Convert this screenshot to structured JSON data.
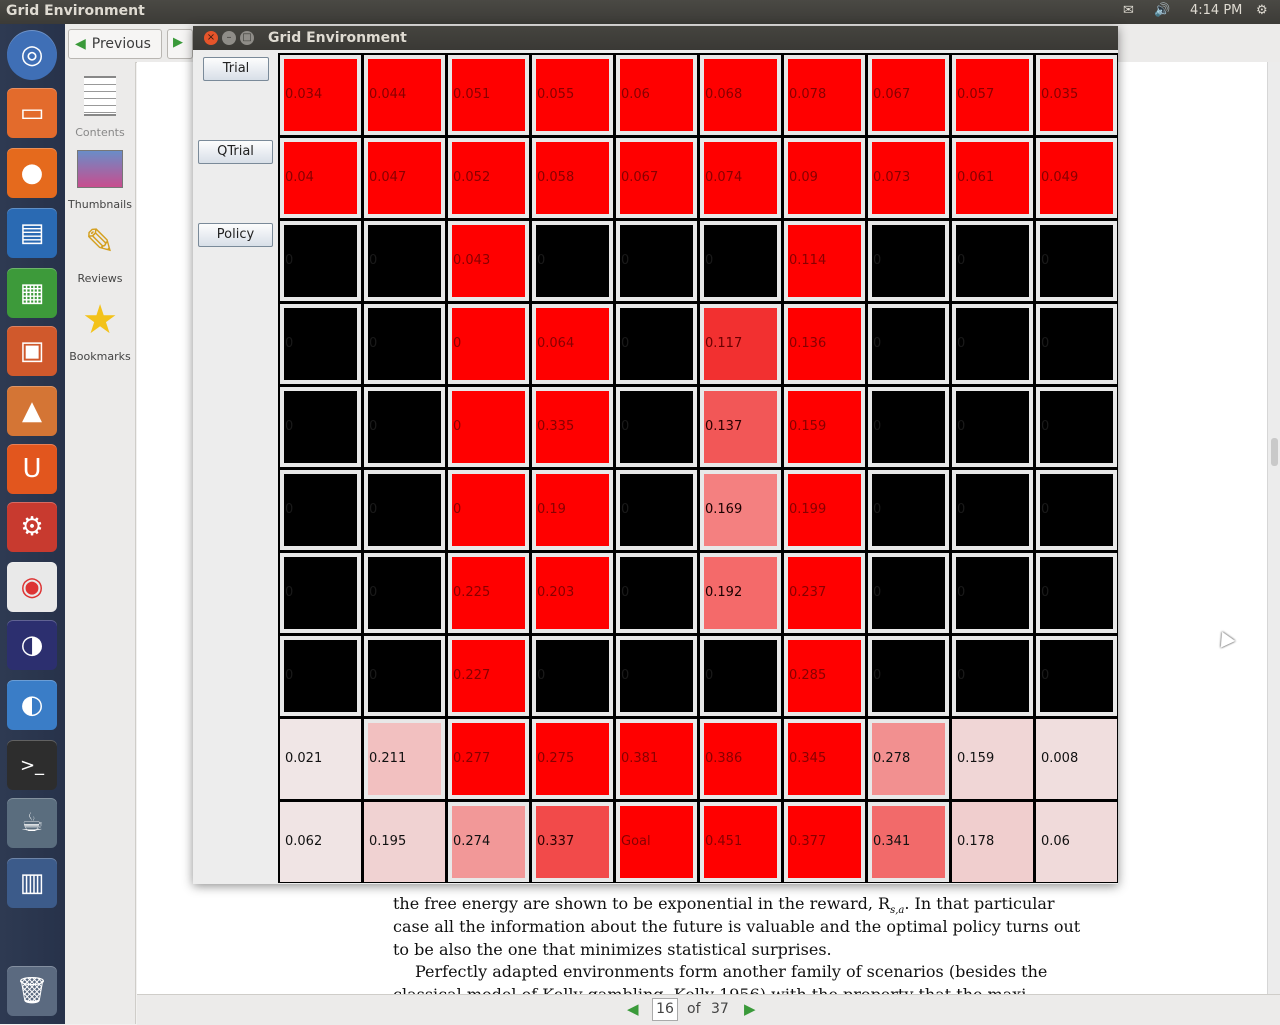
{
  "topbar": {
    "title": "Grid Environment",
    "time": "4:14 PM",
    "indicators": [
      "mail-icon",
      "volume-icon",
      "settings-gear-icon"
    ]
  },
  "launcher": {
    "items": [
      "ubuntu-dash",
      "files",
      "firefox",
      "libreoffice-writer",
      "libreoffice-calc",
      "libreoffice-impress",
      "software-center",
      "ubuntu-one",
      "system-settings",
      "chrome",
      "eclipse",
      "mendeley",
      "terminal",
      "java-app",
      "workspace-switcher",
      "trash"
    ]
  },
  "viewer": {
    "prev_label": "Previous",
    "side": {
      "contents": "Contents",
      "thumbnails": "Thumbnails",
      "reviews": "Reviews",
      "bookmarks": "Bookmarks"
    },
    "doc_lines": [
      "the free energy are shown to be exponential in the reward, R",
      "s,a",
      ". In that particular",
      "case all the information about the future is valuable and the optimal policy turns out",
      "to be also the one that minimizes statistical surprises.",
      "Perfectly adapted environments form another family of scenarios (besides the",
      "classical model of Kelly gambling, Kelly 1956) with the property that the maxi-"
    ],
    "page_current": "16",
    "page_of": "of",
    "page_total": "37"
  },
  "window": {
    "title": "Grid Environment",
    "buttons": {
      "trial": "Trial",
      "qtrial": "QTrial",
      "policy": "Policy"
    }
  },
  "grid": {
    "rows": [
      [
        {
          "v": "0.034",
          "c": "#ff0000",
          "t": "#880000"
        },
        {
          "v": "0.044",
          "c": "#ff0000",
          "t": "#880000"
        },
        {
          "v": "0.051",
          "c": "#ff0000",
          "t": "#880000"
        },
        {
          "v": "0.055",
          "c": "#ff0000",
          "t": "#880000"
        },
        {
          "v": "0.06",
          "c": "#ff0000",
          "t": "#880000"
        },
        {
          "v": "0.068",
          "c": "#ff0000",
          "t": "#880000"
        },
        {
          "v": "0.078",
          "c": "#ff0000",
          "t": "#880000"
        },
        {
          "v": "0.067",
          "c": "#ff0000",
          "t": "#880000"
        },
        {
          "v": "0.057",
          "c": "#ff0000",
          "t": "#880000"
        },
        {
          "v": "0.035",
          "c": "#ff0000",
          "t": "#880000"
        }
      ],
      [
        {
          "v": "0.04",
          "c": "#ff0000",
          "t": "#880000"
        },
        {
          "v": "0.047",
          "c": "#ff0000",
          "t": "#880000"
        },
        {
          "v": "0.052",
          "c": "#ff0000",
          "t": "#880000"
        },
        {
          "v": "0.058",
          "c": "#ff0000",
          "t": "#880000"
        },
        {
          "v": "0.067",
          "c": "#ff0000",
          "t": "#880000"
        },
        {
          "v": "0.074",
          "c": "#ff0000",
          "t": "#880000"
        },
        {
          "v": "0.09",
          "c": "#ff0000",
          "t": "#880000"
        },
        {
          "v": "0.073",
          "c": "#ff0000",
          "t": "#880000"
        },
        {
          "v": "0.061",
          "c": "#ff0000",
          "t": "#880000"
        },
        {
          "v": "0.049",
          "c": "#ff0000",
          "t": "#880000"
        }
      ],
      [
        {
          "v": "0",
          "c": "#000000",
          "t": "#1a1a1a"
        },
        {
          "v": "0",
          "c": "#000000",
          "t": "#1a1a1a"
        },
        {
          "v": "0.043",
          "c": "#ff0000",
          "t": "#880000"
        },
        {
          "v": "0",
          "c": "#000000",
          "t": "#1a1a1a"
        },
        {
          "v": "0",
          "c": "#000000",
          "t": "#1a1a1a"
        },
        {
          "v": "0",
          "c": "#000000",
          "t": "#1a1a1a"
        },
        {
          "v": "0.114",
          "c": "#ff0000",
          "t": "#880000"
        },
        {
          "v": "0",
          "c": "#000000",
          "t": "#1a1a1a"
        },
        {
          "v": "0",
          "c": "#000000",
          "t": "#1a1a1a"
        },
        {
          "v": "0",
          "c": "#000000",
          "t": "#1a1a1a"
        }
      ],
      [
        {
          "v": "0",
          "c": "#000000",
          "t": "#1a1a1a"
        },
        {
          "v": "0",
          "c": "#000000",
          "t": "#1a1a1a"
        },
        {
          "v": "0",
          "c": "#ff0000",
          "t": "#880000"
        },
        {
          "v": "0.064",
          "c": "#ff0000",
          "t": "#880000"
        },
        {
          "v": "0",
          "c": "#000000",
          "t": "#1a1a1a"
        },
        {
          "v": "0.117",
          "c": "#f23030",
          "t": "#6a0000"
        },
        {
          "v": "0.136",
          "c": "#ff0000",
          "t": "#880000"
        },
        {
          "v": "0",
          "c": "#000000",
          "t": "#1a1a1a"
        },
        {
          "v": "0",
          "c": "#000000",
          "t": "#1a1a1a"
        },
        {
          "v": "0",
          "c": "#000000",
          "t": "#1a1a1a"
        }
      ],
      [
        {
          "v": "0",
          "c": "#000000",
          "t": "#1a1a1a"
        },
        {
          "v": "0",
          "c": "#000000",
          "t": "#1a1a1a"
        },
        {
          "v": "0",
          "c": "#ff0000",
          "t": "#880000"
        },
        {
          "v": "0.335",
          "c": "#ff0000",
          "t": "#880000"
        },
        {
          "v": "0",
          "c": "#000000",
          "t": "#1a1a1a"
        },
        {
          "v": "0.137",
          "c": "#f25757",
          "t": "#2a0000"
        },
        {
          "v": "0.159",
          "c": "#ff0000",
          "t": "#880000"
        },
        {
          "v": "0",
          "c": "#000000",
          "t": "#1a1a1a"
        },
        {
          "v": "0",
          "c": "#000000",
          "t": "#1a1a1a"
        },
        {
          "v": "0",
          "c": "#000000",
          "t": "#1a1a1a"
        }
      ],
      [
        {
          "v": "0",
          "c": "#000000",
          "t": "#1a1a1a"
        },
        {
          "v": "0",
          "c": "#000000",
          "t": "#1a1a1a"
        },
        {
          "v": "0",
          "c": "#ff0000",
          "t": "#880000"
        },
        {
          "v": "0.19",
          "c": "#ff0000",
          "t": "#880000"
        },
        {
          "v": "0",
          "c": "#000000",
          "t": "#1a1a1a"
        },
        {
          "v": "0.169",
          "c": "#f48080",
          "t": "#1a0000"
        },
        {
          "v": "0.199",
          "c": "#ff0000",
          "t": "#880000"
        },
        {
          "v": "0",
          "c": "#000000",
          "t": "#1a1a1a"
        },
        {
          "v": "0",
          "c": "#000000",
          "t": "#1a1a1a"
        },
        {
          "v": "0",
          "c": "#000000",
          "t": "#1a1a1a"
        }
      ],
      [
        {
          "v": "0",
          "c": "#000000",
          "t": "#1a1a1a"
        },
        {
          "v": "0",
          "c": "#000000",
          "t": "#1a1a1a"
        },
        {
          "v": "0.225",
          "c": "#ff0000",
          "t": "#880000"
        },
        {
          "v": "0.203",
          "c": "#ff0000",
          "t": "#880000"
        },
        {
          "v": "0",
          "c": "#000000",
          "t": "#1a1a1a"
        },
        {
          "v": "0.192",
          "c": "#f46a6a",
          "t": "#1a0000"
        },
        {
          "v": "0.237",
          "c": "#ff0000",
          "t": "#880000"
        },
        {
          "v": "0",
          "c": "#000000",
          "t": "#1a1a1a"
        },
        {
          "v": "0",
          "c": "#000000",
          "t": "#1a1a1a"
        },
        {
          "v": "0",
          "c": "#000000",
          "t": "#1a1a1a"
        }
      ],
      [
        {
          "v": "0",
          "c": "#000000",
          "t": "#1a1a1a"
        },
        {
          "v": "0",
          "c": "#000000",
          "t": "#1a1a1a"
        },
        {
          "v": "0.227",
          "c": "#ff0000",
          "t": "#880000"
        },
        {
          "v": "0",
          "c": "#000000",
          "t": "#1a1a1a"
        },
        {
          "v": "0",
          "c": "#000000",
          "t": "#1a1a1a"
        },
        {
          "v": "0",
          "c": "#000000",
          "t": "#1a1a1a"
        },
        {
          "v": "0.285",
          "c": "#ff0000",
          "t": "#880000"
        },
        {
          "v": "0",
          "c": "#000000",
          "t": "#1a1a1a"
        },
        {
          "v": "0",
          "c": "#000000",
          "t": "#1a1a1a"
        },
        {
          "v": "0",
          "c": "#000000",
          "t": "#1a1a1a"
        }
      ],
      [
        {
          "v": "0.021",
          "c": "#f0e6e6",
          "t": "#111111"
        },
        {
          "v": "0.211",
          "c": "#f2c0c0",
          "t": "#111111"
        },
        {
          "v": "0.277",
          "c": "#ff0000",
          "t": "#880000"
        },
        {
          "v": "0.275",
          "c": "#ff0000",
          "t": "#880000"
        },
        {
          "v": "0.381",
          "c": "#ff0000",
          "t": "#880000"
        },
        {
          "v": "0.386",
          "c": "#ff0000",
          "t": "#880000"
        },
        {
          "v": "0.345",
          "c": "#ff0000",
          "t": "#880000"
        },
        {
          "v": "0.278",
          "c": "#f29090",
          "t": "#111111"
        },
        {
          "v": "0.159",
          "c": "#f0d6d6",
          "t": "#111111"
        },
        {
          "v": "0.008",
          "c": "#f0dede",
          "t": "#111111"
        }
      ],
      [
        {
          "v": "0.062",
          "c": "#f0e4e4",
          "t": "#111111"
        },
        {
          "v": "0.195",
          "c": "#f0d2d2",
          "t": "#111111"
        },
        {
          "v": "0.274",
          "c": "#f29898",
          "t": "#111111"
        },
        {
          "v": "0.337",
          "c": "#f24a4a",
          "t": "#2a0000"
        },
        {
          "v": "Goal",
          "c": "#ff0000",
          "t": "#880000"
        },
        {
          "v": "0.451",
          "c": "#ff0000",
          "t": "#880000"
        },
        {
          "v": "0.377",
          "c": "#ff0000",
          "t": "#880000"
        },
        {
          "v": "0.341",
          "c": "#f26a6a",
          "t": "#111111"
        },
        {
          "v": "0.178",
          "c": "#f0cece",
          "t": "#111111"
        },
        {
          "v": "0.06",
          "c": "#f0dada",
          "t": "#111111"
        }
      ]
    ]
  }
}
